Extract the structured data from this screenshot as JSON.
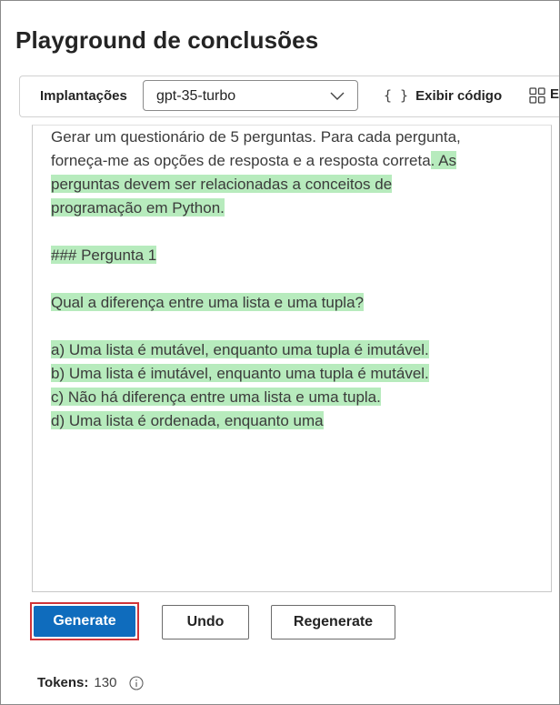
{
  "page": {
    "title": "Playground de conclusões"
  },
  "toolbar": {
    "deployments_label": "Implantações",
    "deployment_value": "gpt-35-turbo",
    "view_code_label": "Exibir código",
    "view_code_icon": "{ }",
    "truncated_next_label": "E"
  },
  "editor": {
    "lines": [
      {
        "plain": "Gerar um questionário de 5 perguntas. Para cada pergunta,",
        "hl": ""
      },
      {
        "plain": "forneça-me as opções de resposta e a resposta correta",
        "hl": ". As"
      },
      {
        "plain": "",
        "hl": "perguntas devem ser relacionadas a conceitos de"
      },
      {
        "plain": "",
        "hl": "programação em Python."
      },
      {
        "plain": "",
        "hl": ""
      },
      {
        "plain": "",
        "hl": "### Pergunta 1"
      },
      {
        "plain": "",
        "hl": ""
      },
      {
        "plain": "",
        "hl": "Qual a diferença entre uma lista e uma tupla?"
      },
      {
        "plain": "",
        "hl": ""
      },
      {
        "plain": "",
        "hl": "a) Uma lista é mutável, enquanto uma tupla é imutável."
      },
      {
        "plain": "",
        "hl": "b) Uma lista é imutável, enquanto uma tupla é mutável."
      },
      {
        "plain": "",
        "hl": "c) Não há diferença entre uma lista e uma tupla."
      },
      {
        "plain": "",
        "hl": "d) Uma lista é ordenada, enquanto uma"
      }
    ]
  },
  "actions": {
    "generate_label": "Generate",
    "undo_label": "Undo",
    "regenerate_label": "Regenerate"
  },
  "status": {
    "tokens_label": "Tokens:",
    "tokens_value": "130"
  },
  "colors": {
    "accent": "#0f6cbd",
    "highlight": "#b7ebbd",
    "focus_outline": "#d13438"
  }
}
